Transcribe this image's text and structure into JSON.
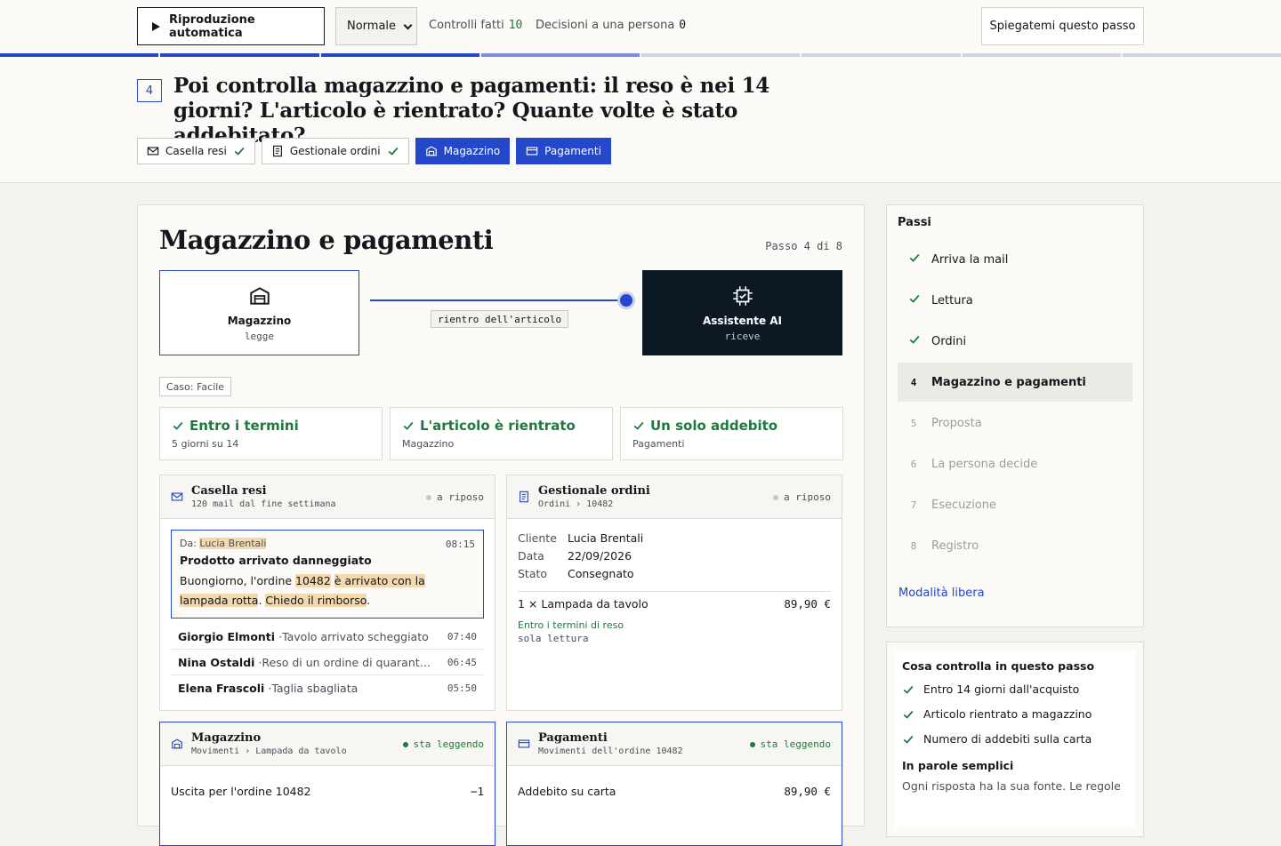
{
  "toolbar": {
    "play_label": "Riproduzione automatica",
    "speed_selected": "Normale",
    "checks_label": "Controlli fatti",
    "checks_count": "10",
    "decisions_label": "Decisioni a una persona",
    "decisions_count": "0",
    "explain_label": "Spiegatemi questo passo"
  },
  "progress": {
    "segments_total": 8,
    "segments_done": 3,
    "current_index": 3
  },
  "header": {
    "step_number": "4",
    "title": "Poi controlla magazzino e pagamenti: il reso è nei 14 giorni? L'articolo è rientrato? Quante volte è stato addebitato?",
    "chips": [
      {
        "label": "Casella resi",
        "icon": "mail-icon",
        "state": "done"
      },
      {
        "label": "Gestionale ordini",
        "icon": "document-icon",
        "state": "done"
      },
      {
        "label": "Magazzino",
        "icon": "warehouse-icon",
        "state": "active"
      },
      {
        "label": "Pagamenti",
        "icon": "card-icon",
        "state": "active"
      }
    ]
  },
  "main": {
    "title": "Magazzino e pagamenti",
    "step_of": "Passo 4 di 8",
    "flow": {
      "source": {
        "label": "Magazzino",
        "role": "legge"
      },
      "edge": "rientro dell'articolo",
      "target": {
        "label": "Assistente AI",
        "role": "riceve"
      }
    },
    "case_tag": "Caso: Facile",
    "checks": [
      {
        "title": "Entro i termini",
        "sub": "5 giorni su 14"
      },
      {
        "title": "L'articolo è rientrato",
        "sub": "Magazzino"
      },
      {
        "title": "Un solo addebito",
        "sub": "Pagamenti"
      }
    ],
    "inbox": {
      "title": "Casella resi",
      "sub": "120 mail dal fine settimana",
      "status": "a riposo",
      "selected": {
        "from_label": "Da:",
        "from_name": "Lucia Brentali",
        "time": "08:15",
        "subject": "Prodotto arrivato danneggiato",
        "body_1": "Buongiorno, l'ordine ",
        "body_order": "10482",
        "body_2": " ",
        "body_damaged": "è arrivato con la lampada rotta",
        "body_3": ". ",
        "body_refund": "Chiedo il rimborso",
        "body_4": "."
      },
      "rows": [
        {
          "name": "Giorgio Elmonti",
          "subject": "Tavolo arrivato scheggiato",
          "time": "07:40"
        },
        {
          "name": "Nina Ostaldi",
          "subject": "Reso di un ordine di quaranta giorni fa",
          "time": "06:45"
        },
        {
          "name": "Elena Frascoli",
          "subject": "Taglia sbagliata",
          "time": "05:50"
        }
      ]
    },
    "orders": {
      "title": "Gestionale ordini",
      "sub": "Ordini › 10482",
      "status": "a riposo",
      "fields": [
        {
          "k": "Cliente",
          "v": "Lucia Brentali"
        },
        {
          "k": "Data",
          "v": "22/09/2026"
        },
        {
          "k": "Stato",
          "v": "Consegnato"
        }
      ],
      "line_item": "1 × Lampada da tavolo",
      "line_price": "89,90 €",
      "note": "Entro i termini di reso",
      "readonly": "sola lettura"
    },
    "warehouse": {
      "title": "Magazzino",
      "sub": "Movimenti › Lampada da tavolo",
      "status": "sta leggendo",
      "row_label": "Uscita per l'ordine 10482",
      "row_value": "−1"
    },
    "payments": {
      "title": "Pagamenti",
      "sub": "Movimenti dell'ordine 10482",
      "status": "sta leggendo",
      "row_label": "Addebito su carta",
      "row_value": "89,90 €"
    }
  },
  "sidebar": {
    "title": "Passi",
    "steps": [
      {
        "num": "1",
        "label": "Arriva la mail",
        "state": "done"
      },
      {
        "num": "2",
        "label": "Lettura",
        "state": "done"
      },
      {
        "num": "3",
        "label": "Ordini",
        "state": "done"
      },
      {
        "num": "4",
        "label": "Magazzino e pagamenti",
        "state": "current"
      },
      {
        "num": "5",
        "label": "Proposta",
        "state": "pending"
      },
      {
        "num": "6",
        "label": "La persona decide",
        "state": "pending"
      },
      {
        "num": "7",
        "label": "Esecuzione",
        "state": "pending"
      },
      {
        "num": "8",
        "label": "Registro",
        "state": "pending"
      }
    ],
    "free_mode": "Modalità libera"
  },
  "explainer": {
    "title": "Cosa controlla in questo passo",
    "items": [
      "Entro 14 giorni dall'acquisto",
      "Articolo rientrato a magazzino",
      "Numero di addebiti sulla carta"
    ],
    "plain_title": "In parole semplici",
    "plain_text": "Ogni risposta ha la sua fonte. Le regole"
  },
  "colors": {
    "accent": "#2547c9",
    "success": "#1e7a3c",
    "dark": "#0c1824",
    "highlight": "#f3d9b0"
  }
}
